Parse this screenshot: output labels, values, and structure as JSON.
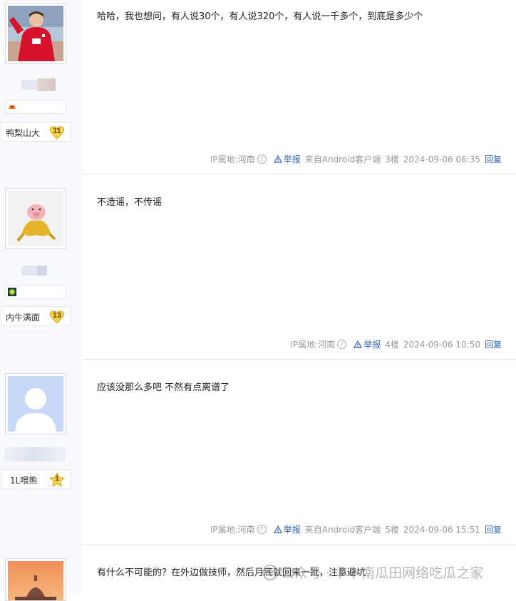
{
  "posts": [
    {
      "avatar": "soccer-player-avatar",
      "badge_icon": "fan-badge-icon",
      "level_name": "鸭梨山大",
      "level": "11",
      "content": "哈哈，我也想问，有人说30个，有人说320个，有人说一千多个，到底是多少个",
      "ip": "IP属地:河南",
      "report": "举报",
      "source": "来自Android客户端",
      "floor": "3楼",
      "time": "2024-09-06 06:35",
      "reply": "回复"
    },
    {
      "avatar": "pig-avatar",
      "badge_icon": "flower-badge-icon",
      "level_name": "内牛满面",
      "level": "13",
      "content": "不造谣，不传谣",
      "ip": "IP属地:河南",
      "report": "举报",
      "source": "",
      "floor": "4楼",
      "time": "2024-09-06 10:50",
      "reply": "回复"
    },
    {
      "avatar": "default-user-avatar",
      "level_name": "1L喂熊",
      "level": "1",
      "content": "应该没那么多吧 不然有点离谱了",
      "ip": "IP属地:河南",
      "report": "举报",
      "source": "来自Android客户端",
      "floor": "5楼",
      "time": "2024-09-06 15:51",
      "reply": "回复"
    },
    {
      "avatar": "sunset-dome-avatar",
      "content": "有什么不可能的？在外边做技师，然后月底就回来一批，注意避坑"
    }
  ],
  "watermark": "公众号 · 卜卜南瓜田网络吃瓜之家",
  "colors": {
    "link": "#2d64b3",
    "sidebar_bg": "#f9fafd",
    "divider": "#e4e6eb",
    "level_badge": "#f7d24a"
  }
}
